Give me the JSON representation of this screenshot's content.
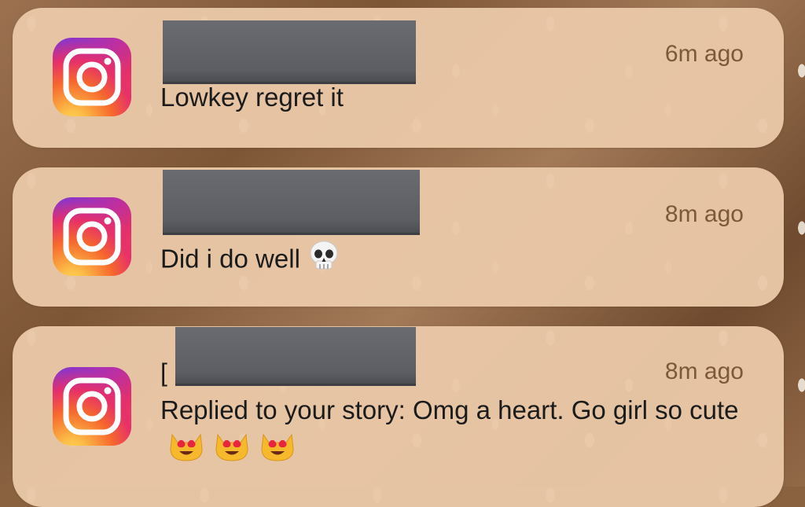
{
  "notifications": [
    {
      "app": "Instagram",
      "app_icon": "instagram-icon",
      "sender_prefix": "",
      "time": "6m ago",
      "message": "Lowkey regret it",
      "emojis": []
    },
    {
      "app": "Instagram",
      "app_icon": "instagram-icon",
      "sender_prefix": "",
      "time": "8m ago",
      "message": "Did i do well",
      "emojis": [
        "skull-emoji"
      ]
    },
    {
      "app": "Instagram",
      "app_icon": "instagram-icon",
      "sender_prefix": "[",
      "time": "8m ago",
      "message": "Replied to your story: Omg a heart. Go girl so cute",
      "emojis": [
        "heart-eyes-cat-emoji",
        "heart-eyes-cat-emoji",
        "heart-eyes-cat-emoji"
      ]
    }
  ],
  "colors": {
    "card": "#e9c8a8",
    "time": "#7a5a3a",
    "text": "#1b1b1b",
    "redaction": "#5d5e63"
  }
}
